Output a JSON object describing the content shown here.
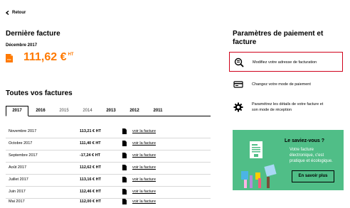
{
  "nav": {
    "back_label": "Retour"
  },
  "last_invoice": {
    "title": "Dernière facture",
    "month": "Décembre 2017",
    "file_label": "PDF",
    "amount": "111,62 €",
    "tax_label": "HT"
  },
  "invoices": {
    "title": "Toutes vos factures",
    "years": [
      {
        "label": "2017",
        "state": "active"
      },
      {
        "label": "2016",
        "state": "normal"
      },
      {
        "label": "2015",
        "state": "muted"
      },
      {
        "label": "2014",
        "state": "muted"
      },
      {
        "label": "2013",
        "state": "normal"
      },
      {
        "label": "2012",
        "state": "normal"
      },
      {
        "label": "2011",
        "state": "normal"
      }
    ],
    "rows": [
      {
        "month": "Novembre 2017",
        "amount": "113,21 € HT",
        "link": "voir la facture"
      },
      {
        "month": "Octobre 2017",
        "amount": "111,40 € HT",
        "link": "voir la facture"
      },
      {
        "month": "Septembre 2017",
        "amount": "-17,24 € HT",
        "link": "voir la facture"
      },
      {
        "month": "Août 2017",
        "amount": "112,62 € HT",
        "link": "voir la facture"
      },
      {
        "month": "Juillet 2017",
        "amount": "113,16 € HT",
        "link": "voir la facture"
      },
      {
        "month": "Juin 2017",
        "amount": "112,46 € HT",
        "link": "voir la facture"
      },
      {
        "month": "Mai 2017",
        "amount": "112,00 € HT",
        "link": "voir la facture"
      }
    ]
  },
  "settings": {
    "title_line1": "Paramètres de paiement et",
    "title_line2": "facture",
    "address_label": "Modifiez votre adresse de facturation",
    "payment_label": "Changez votre mode de paiement",
    "details_line1": "Paramétrez les détails de votre facture et",
    "details_line2": "son mode de réception"
  },
  "promo": {
    "title": "Le saviez-vous ?",
    "body_line1": "Votre facture",
    "body_line2": "électronique, c'est",
    "body_line3": "pratique et écologique.",
    "button_label": "En savoir plus"
  },
  "colors": {
    "accent": "#ff7900",
    "promo_bg": "#50be87",
    "highlight": "#d0021b"
  }
}
